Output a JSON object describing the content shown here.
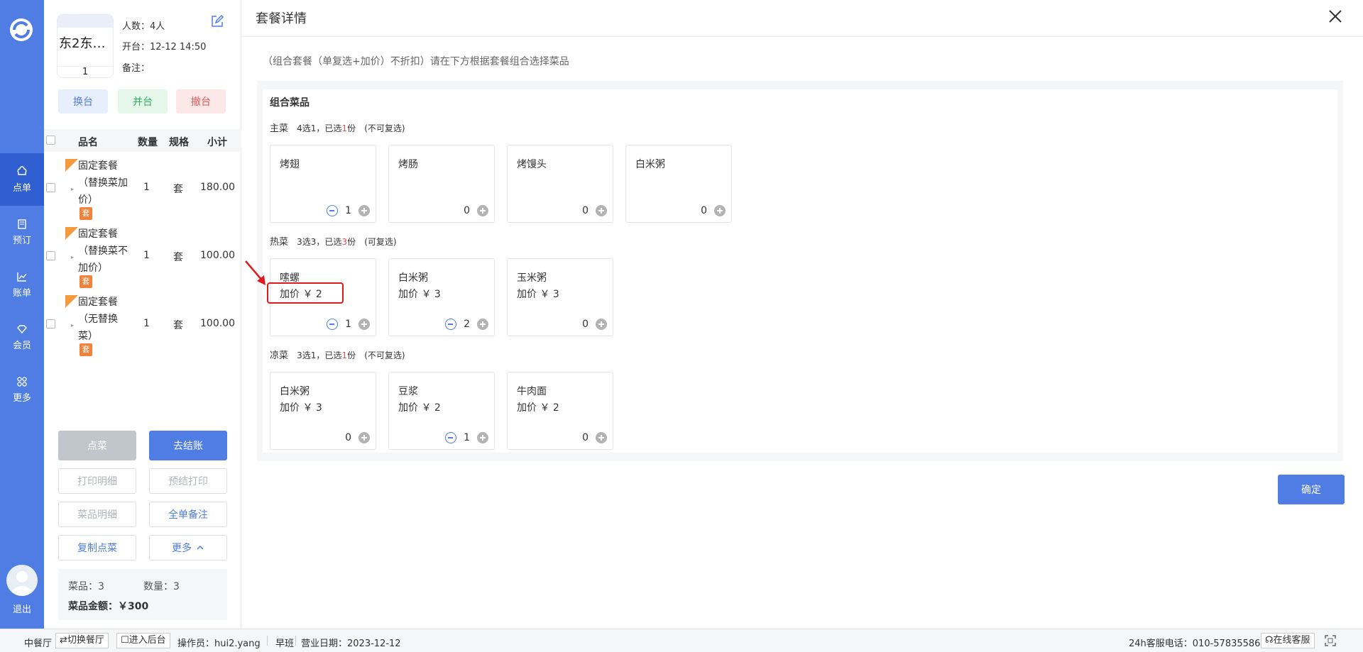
{
  "nav": {
    "items": [
      {
        "label": "点单",
        "icon": "chef-hat-icon"
      },
      {
        "label": "预订",
        "icon": "book-icon"
      },
      {
        "label": "账单",
        "icon": "chart-icon"
      },
      {
        "label": "会员",
        "icon": "diamond-icon"
      },
      {
        "label": "更多",
        "icon": "grid-icon"
      }
    ],
    "logout": "退出"
  },
  "table": {
    "name": "东2东…",
    "number": "1",
    "people": "人数：4人",
    "opened": "开台：12-12 14:50",
    "note": "备注："
  },
  "actions": {
    "swap": "换台",
    "join": "并台",
    "cancel": "撤台"
  },
  "columns": {
    "name": "品名",
    "qty": "数量",
    "unit": "规格",
    "subtotal": "小计"
  },
  "orders": [
    {
      "name": "固定套餐（替换菜加价）",
      "qty": "1",
      "unit": "套",
      "subtotal": "180.00",
      "badge": "套"
    },
    {
      "name": "固定套餐（替换菜不加价）",
      "qty": "1",
      "unit": "套",
      "subtotal": "100.00",
      "badge": "套"
    },
    {
      "name": "固定套餐（无替换菜）",
      "qty": "1",
      "unit": "套",
      "subtotal": "100.00",
      "badge": "套"
    }
  ],
  "buttons": {
    "order": "点菜",
    "checkout": "去结账",
    "print_detail": "打印明细",
    "pre_print": "预结打印",
    "dish_detail": "菜品明细",
    "order_note": "全单备注",
    "copy_order": "复制点菜",
    "more": "更多"
  },
  "summary": {
    "dishes": "菜品：3",
    "quantity": "数量：3",
    "amount": "菜品金额：￥300"
  },
  "dialog": {
    "title": "套餐详情",
    "hint": "（组合套餐（单复选+加价）不折扣）请在下方根据套餐组合选择菜品",
    "section": "组合菜品",
    "confirm": "确定",
    "groups": [
      {
        "name": "主菜",
        "rule_pre": "4选1，已选",
        "selected": "1",
        "rule_post": "份",
        "multi": "(不可复选)",
        "items": [
          {
            "name": "烤翅",
            "price": "",
            "count": "1",
            "minus": true
          },
          {
            "name": "烤肠",
            "price": "",
            "count": "0",
            "minus": false
          },
          {
            "name": "烤馒头",
            "price": "",
            "count": "0",
            "minus": false
          },
          {
            "name": "白米粥",
            "price": "",
            "count": "0",
            "minus": false
          }
        ]
      },
      {
        "name": "热菜",
        "rule_pre": "3选3，已选",
        "selected": "3",
        "rule_post": "份",
        "multi": "(可复选)",
        "items": [
          {
            "name": "嗦螺",
            "price": "加价 ￥ 2",
            "count": "1",
            "minus": true
          },
          {
            "name": "白米粥",
            "price": "加价 ￥ 3",
            "count": "2",
            "minus": true
          },
          {
            "name": "玉米粥",
            "price": "加价 ￥ 3",
            "count": "0",
            "minus": false
          }
        ]
      },
      {
        "name": "凉菜",
        "rule_pre": "3选1，已选",
        "selected": "1",
        "rule_post": "份",
        "multi": "(不可复选)",
        "items": [
          {
            "name": "白米粥",
            "price": "加价 ￥ 3",
            "count": "0",
            "minus": false
          },
          {
            "name": "豆浆",
            "price": "加价 ￥ 2",
            "count": "1",
            "minus": true
          },
          {
            "name": "牛肉面",
            "price": "加价 ￥ 2",
            "count": "0",
            "minus": false
          }
        ]
      }
    ]
  },
  "status": {
    "hall": "中餐厅",
    "switch": "切换餐厅",
    "backend": "进入后台",
    "operator": "操作员：hui2.yang",
    "shift": "早班",
    "date": "营业日期：2023-12-12",
    "phone": "24h客服电话：010-57835586",
    "service": "在线客服"
  },
  "colors": {
    "accent": "#4f7de3",
    "orange": "#f0823a",
    "red": "#e01a1a"
  }
}
